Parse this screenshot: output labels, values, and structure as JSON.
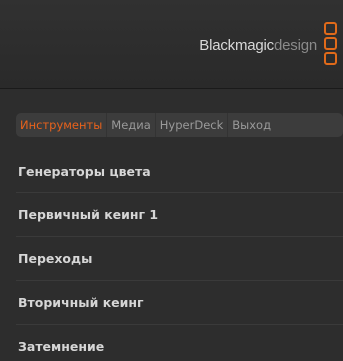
{
  "header": {
    "brand_blackmagic": "Blackmagic",
    "brand_design": "design",
    "logo_color": "#e06a1a"
  },
  "tabs": [
    {
      "label": "Инструменты",
      "active": true
    },
    {
      "label": "Медиа",
      "active": false
    },
    {
      "label": "HyperDeck",
      "active": false
    },
    {
      "label": "Выход",
      "active": false
    }
  ],
  "menu": {
    "items": [
      {
        "label": "Генераторы цвета"
      },
      {
        "label": "Первичный кеинг 1"
      },
      {
        "label": "Переходы"
      },
      {
        "label": "Вторичный кеинг"
      },
      {
        "label": "Затемнение"
      }
    ]
  },
  "colors": {
    "accent": "#e8621c",
    "background": "#2d2d2d",
    "text": "#d6d6d6"
  }
}
